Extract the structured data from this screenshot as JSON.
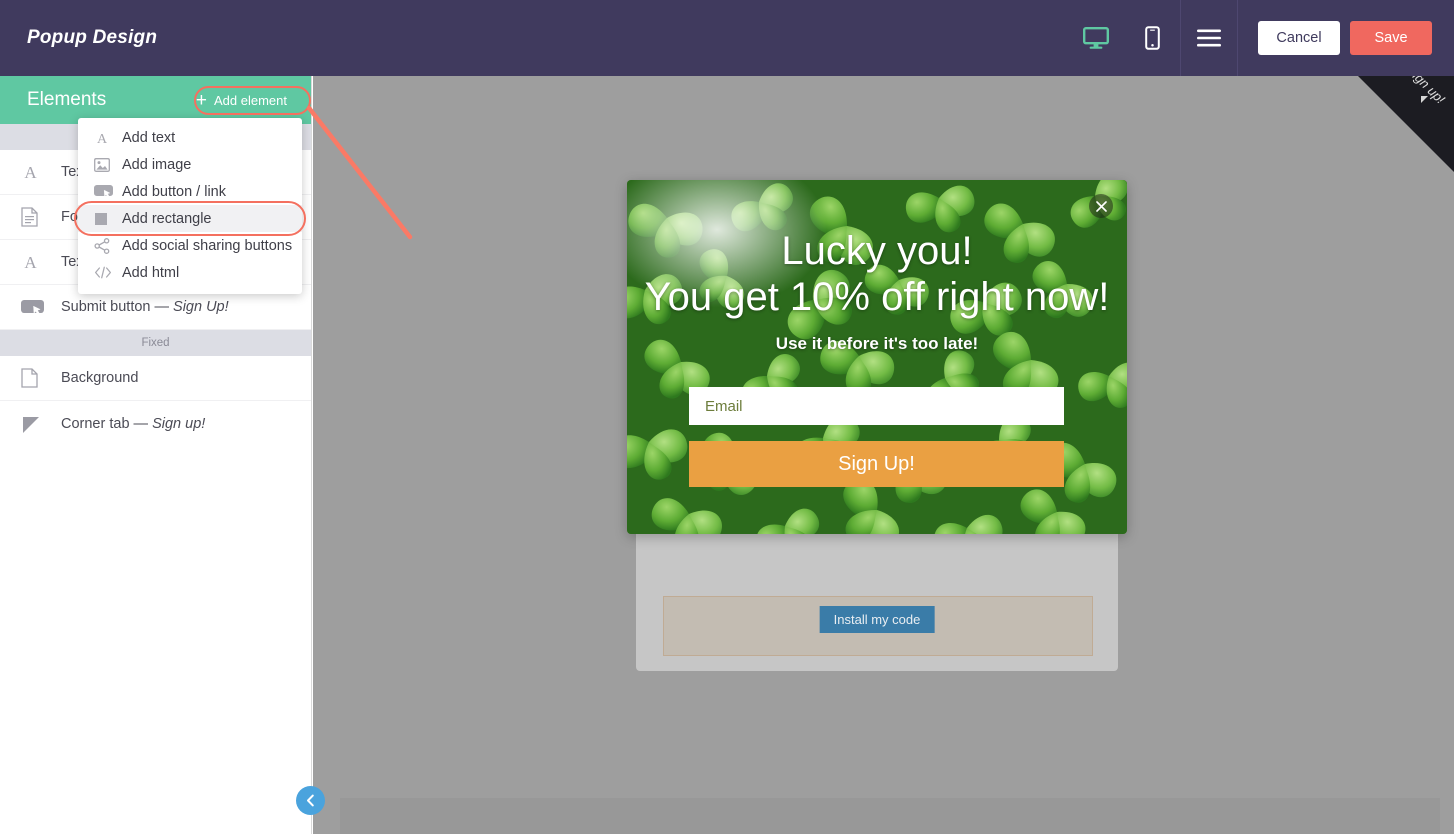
{
  "header": {
    "title": "Popup Design",
    "icons": [
      {
        "name": "desktop-icon",
        "label": "Desktop view",
        "active": true
      },
      {
        "name": "mobile-icon",
        "label": "Mobile view",
        "active": false
      },
      {
        "name": "hamburger-menu-icon",
        "label": "Menu",
        "active": false
      }
    ],
    "cancel_label": "Cancel",
    "save_label": "Save",
    "bg_color": "#403a5e",
    "save_color": "#f0685f",
    "active_icon_color": "#5fc8a2"
  },
  "sidebar": {
    "title": "Elements",
    "add_element_label": "Add element",
    "header_color": "#5fc8a2",
    "groups": [
      {
        "label": "",
        "items": [
          {
            "icon": "text-icon",
            "label": "Text",
            "truncated": "Tex"
          },
          {
            "icon": "form-icon",
            "label": "Form",
            "truncated": "For"
          },
          {
            "icon": "text-icon",
            "label": "Text",
            "truncated": "Tex"
          },
          {
            "icon": "button-icon",
            "label": "Submit button — ",
            "emphasis": "Sign Up!"
          }
        ]
      },
      {
        "label": "Fixed",
        "items": [
          {
            "icon": "page-icon",
            "label": "Background",
            "emphasis": ""
          },
          {
            "icon": "corner-tab-icon",
            "label": "Corner tab — ",
            "emphasis": "Sign up!"
          }
        ]
      }
    ],
    "collapse_icon": "chevron-left-icon"
  },
  "dropdown": {
    "visible": true,
    "highlight_color": "#f4705f",
    "items": [
      {
        "icon": "add-text-icon",
        "label": "Add text",
        "glyph": "A",
        "highlighted": false
      },
      {
        "icon": "add-image-icon",
        "label": "Add image",
        "glyph": "image",
        "highlighted": false
      },
      {
        "icon": "add-button-icon",
        "label": "Add button / link",
        "glyph": "button",
        "highlighted": false
      },
      {
        "icon": "add-rectangle-icon",
        "label": "Add rectangle",
        "glyph": "square",
        "highlighted": true
      },
      {
        "icon": "add-social-icon",
        "label": "Add social sharing buttons",
        "glyph": "share",
        "highlighted": false
      },
      {
        "icon": "add-html-icon",
        "label": "Add html",
        "glyph": "code",
        "highlighted": false
      }
    ]
  },
  "canvas": {
    "bg_color": "#9e9e9e",
    "install_button_label": "Install my code",
    "install_button_color": "#3a7ca8"
  },
  "popup": {
    "headline_line1": "Lucky you!",
    "headline_line2": "You get 10% off right now!",
    "subheadline": "Use it before it's too late!",
    "email_placeholder": "Email",
    "email_value": "",
    "submit_label": "Sign Up!",
    "submit_color": "#eaa042",
    "close_icon": "close-icon",
    "background": "clover-photo"
  },
  "corner_tab": {
    "label": "Sign up!",
    "color": "#1c1c22"
  }
}
